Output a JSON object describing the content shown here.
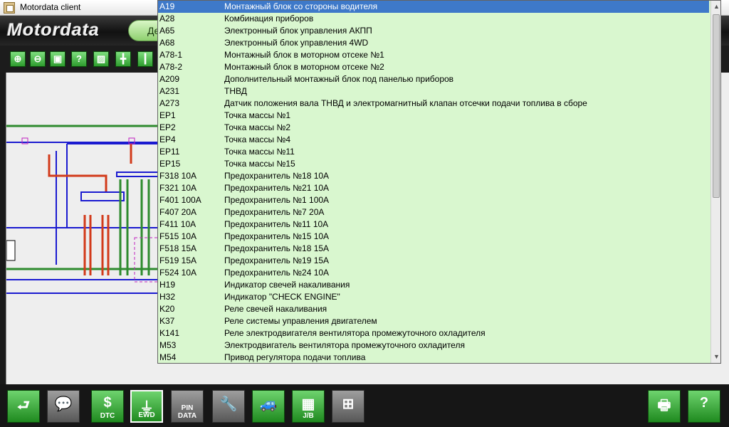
{
  "window": {
    "title": "Motordata client"
  },
  "brand": {
    "logo": "Motordata",
    "pill_label": "Де"
  },
  "toolbar": {
    "buttons": [
      {
        "name": "zoom-in-button",
        "icon": "⊕"
      },
      {
        "name": "zoom-out-button",
        "icon": "⊖"
      },
      {
        "name": "fit-button",
        "icon": "▣"
      },
      {
        "name": "help-button",
        "icon": "?"
      },
      {
        "name": "color-button",
        "icon": "▨"
      },
      {
        "name": "split-h-button",
        "icon": "╋"
      },
      {
        "name": "split-v-button",
        "icon": "┃"
      }
    ]
  },
  "components": [
    {
      "code": "A19",
      "desc": "Монтажный блок со стороны водителя",
      "selected": true
    },
    {
      "code": "A28",
      "desc": "Комбинация приборов"
    },
    {
      "code": "A65",
      "desc": "Электронный блок управления АКПП"
    },
    {
      "code": "A68",
      "desc": "Электронный блок управления 4WD"
    },
    {
      "code": "A78-1",
      "desc": "Монтажный блок в моторном отсеке №1"
    },
    {
      "code": "A78-2",
      "desc": "Монтажный блок в моторном отсеке №2"
    },
    {
      "code": "A209",
      "desc": "Дополнительный монтажный блок под панелью приборов"
    },
    {
      "code": "A231",
      "desc": "ТНВД"
    },
    {
      "code": "A273",
      "desc": "Датчик положения вала ТНВД и электромагнитный клапан отсечки подачи топлива в сборе"
    },
    {
      "code": "EP1",
      "desc": "Точка массы №1"
    },
    {
      "code": "EP2",
      "desc": "Точка массы №2"
    },
    {
      "code": "EP4",
      "desc": "Точка массы №4"
    },
    {
      "code": "EP11",
      "desc": "Точка массы №11"
    },
    {
      "code": "EP15",
      "desc": "Точка массы №15"
    },
    {
      "code": "F318 10A",
      "desc": "Предохранитель №18 10A"
    },
    {
      "code": "F321 10A",
      "desc": "Предохранитель №21 10A"
    },
    {
      "code": "F401 100A",
      "desc": "Предохранитель №1 100A"
    },
    {
      "code": "F407 20A",
      "desc": "Предохранитель №7 20A"
    },
    {
      "code": "F411 10A",
      "desc": "Предохранитель №11 10A"
    },
    {
      "code": "F515 10A",
      "desc": "Предохранитель №15 10A"
    },
    {
      "code": "F518 15A",
      "desc": "Предохранитель №18 15A"
    },
    {
      "code": "F519 15A",
      "desc": "Предохранитель №19 15A"
    },
    {
      "code": "F524 10A",
      "desc": "Предохранитель №24 10A"
    },
    {
      "code": "H19",
      "desc": "Индикатор свечей накаливания"
    },
    {
      "code": "H32",
      "desc": "Индикатор \"CHECK ENGINE\""
    },
    {
      "code": "K20",
      "desc": "Реле свечей накаливания"
    },
    {
      "code": "K37",
      "desc": "Реле системы управления двигателем"
    },
    {
      "code": "K141",
      "desc": "Реле электродвигателя вентилятора промежуточного охладителя"
    },
    {
      "code": "M53",
      "desc": "Электродвигатель вентилятора промежуточного охладителя"
    },
    {
      "code": "M54",
      "desc": "Привод регулятора подачи топлива"
    }
  ],
  "bottombar": {
    "buttons": [
      {
        "name": "back-button",
        "label": "",
        "icon": "⮐",
        "style": "green"
      },
      {
        "name": "messages-button",
        "label": "",
        "icon": "💬",
        "style": "gray"
      },
      {
        "name": "dtc-button",
        "label": "DTC",
        "icon": "$",
        "style": "green"
      },
      {
        "name": "ewd-button",
        "label": "EWD",
        "icon": "⏚",
        "style": "green",
        "active": true
      },
      {
        "name": "pin-data-button",
        "label": "PIN DATA",
        "icon": "",
        "style": "gray"
      },
      {
        "name": "tools-button",
        "label": "",
        "icon": "🔧",
        "style": "gray"
      },
      {
        "name": "repair-cost-button",
        "label": "",
        "icon": "🚙",
        "style": "green"
      },
      {
        "name": "jb-button",
        "label": "J/B",
        "icon": "▦",
        "style": "green"
      },
      {
        "name": "connector-button",
        "label": "",
        "icon": "⊞",
        "style": "gray"
      },
      {
        "name": "print-button",
        "label": "",
        "icon": "🖶",
        "style": "green"
      },
      {
        "name": "manual-button",
        "label": "",
        "icon": "?",
        "style": "green"
      }
    ]
  },
  "colors": {
    "list_bg": "#d9f7cf",
    "selection": "#3e79c9",
    "wire_blue": "#1a1ad0",
    "wire_red": "#d23a1a",
    "wire_green": "#2e8b2e",
    "connector_magenta": "#c020c0"
  }
}
